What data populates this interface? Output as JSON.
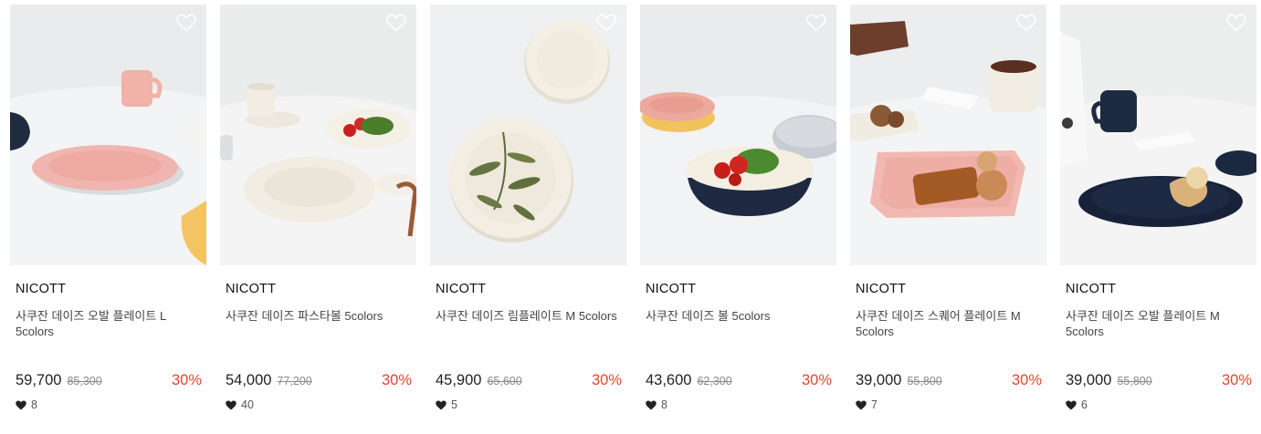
{
  "products": [
    {
      "brand": "NICOTT",
      "title": "사쿠잔 데이즈 오발 플레이트 L 5colors",
      "price": "59,700",
      "original_price": "85,300",
      "discount": "30%",
      "likes": "8",
      "image": "oval-plate-pink"
    },
    {
      "brand": "NICOTT",
      "title": "사쿠잔 데이즈 파스타볼 5colors",
      "price": "54,000",
      "original_price": "77,200",
      "discount": "30%",
      "likes": "40",
      "image": "pasta-bowl-ivory"
    },
    {
      "brand": "NICOTT",
      "title": "사쿠잔 데이즈 림플레이트 M 5colors",
      "price": "45,900",
      "original_price": "65,600",
      "discount": "30%",
      "likes": "5",
      "image": "rim-plate-ivory"
    },
    {
      "brand": "NICOTT",
      "title": "사쿠잔 데이즈 볼 5colors",
      "price": "43,600",
      "original_price": "62,300",
      "discount": "30%",
      "likes": "8",
      "image": "bowl-navy"
    },
    {
      "brand": "NICOTT",
      "title": "사쿠잔 데이즈 스퀘어 플레이트 M 5colors",
      "price": "39,000",
      "original_price": "55,800",
      "discount": "30%",
      "likes": "7",
      "image": "square-plate-pink"
    },
    {
      "brand": "NICOTT",
      "title": "사쿠잔 데이즈 오발 플레이트 M 5colors",
      "price": "39,000",
      "original_price": "55,800",
      "discount": "30%",
      "likes": "6",
      "image": "oval-plate-navy"
    }
  ],
  "colors": {
    "discount": "#e5452c",
    "price": "#222222",
    "original_price": "#8a8a8a"
  }
}
